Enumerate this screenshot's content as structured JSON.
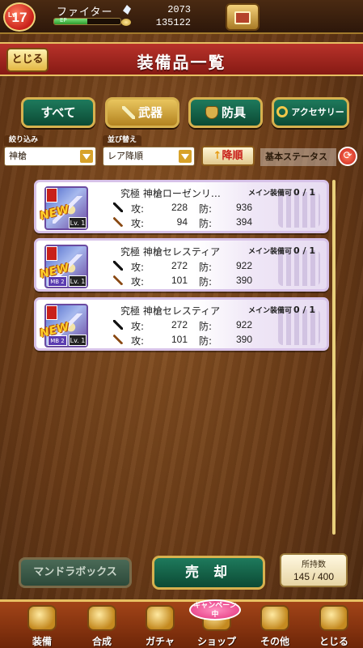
{
  "status": {
    "level_prefix": "Lv",
    "level": "17",
    "job_name": "ファイター",
    "ep_label": "EP",
    "ep_fraction": 0.5,
    "stones": "2073",
    "gold": "135122"
  },
  "header": {
    "title": "装備品一覧",
    "close_label": "とじる"
  },
  "filters": {
    "all_label": "すべて",
    "weapon_label": "武器",
    "armor_label": "防具",
    "accessory_label": "アクセサリー",
    "active": "weapon"
  },
  "controls": {
    "narrow_label": "絞り込み",
    "narrow_value": "神槍",
    "sort_label": "並び替え",
    "sort_value": "レア降順",
    "order_label": "降順",
    "stat_label": "基本ステータス"
  },
  "items": [
    {
      "name": "究極 神槍ローゼンリ…",
      "equip_note": "メイン装備可",
      "equip_count": "0 / 1",
      "atk1": "228",
      "def1": "936",
      "atk2": "94",
      "def2": "394",
      "new": "NEW",
      "lv": "Lv. 1",
      "mb": ""
    },
    {
      "name": "究極 神槍セレスティア",
      "equip_note": "メイン装備可",
      "equip_count": "0 / 1",
      "atk1": "272",
      "def1": "922",
      "atk2": "101",
      "def2": "390",
      "new": "NEW",
      "lv": "Lv. 1",
      "mb": "MB 2"
    },
    {
      "name": "究極 神槍セレスティア",
      "equip_note": "メイン装備可",
      "equip_count": "0 / 1",
      "atk1": "272",
      "def1": "922",
      "atk2": "101",
      "def2": "390",
      "new": "NEW",
      "lv": "Lv. 1",
      "mb": "MB 2"
    }
  ],
  "stat_keys": {
    "atk": "攻:",
    "def": "防:"
  },
  "actions": {
    "box_label": "マンドラボックス",
    "sell_label": "売 却",
    "count_label": "所持数",
    "count_value": "145 / 400"
  },
  "nav": {
    "items": [
      "装備",
      "合成",
      "ガチャ",
      "ショップ",
      "その他",
      "とじる"
    ],
    "campaign": "キャンペーン中"
  }
}
